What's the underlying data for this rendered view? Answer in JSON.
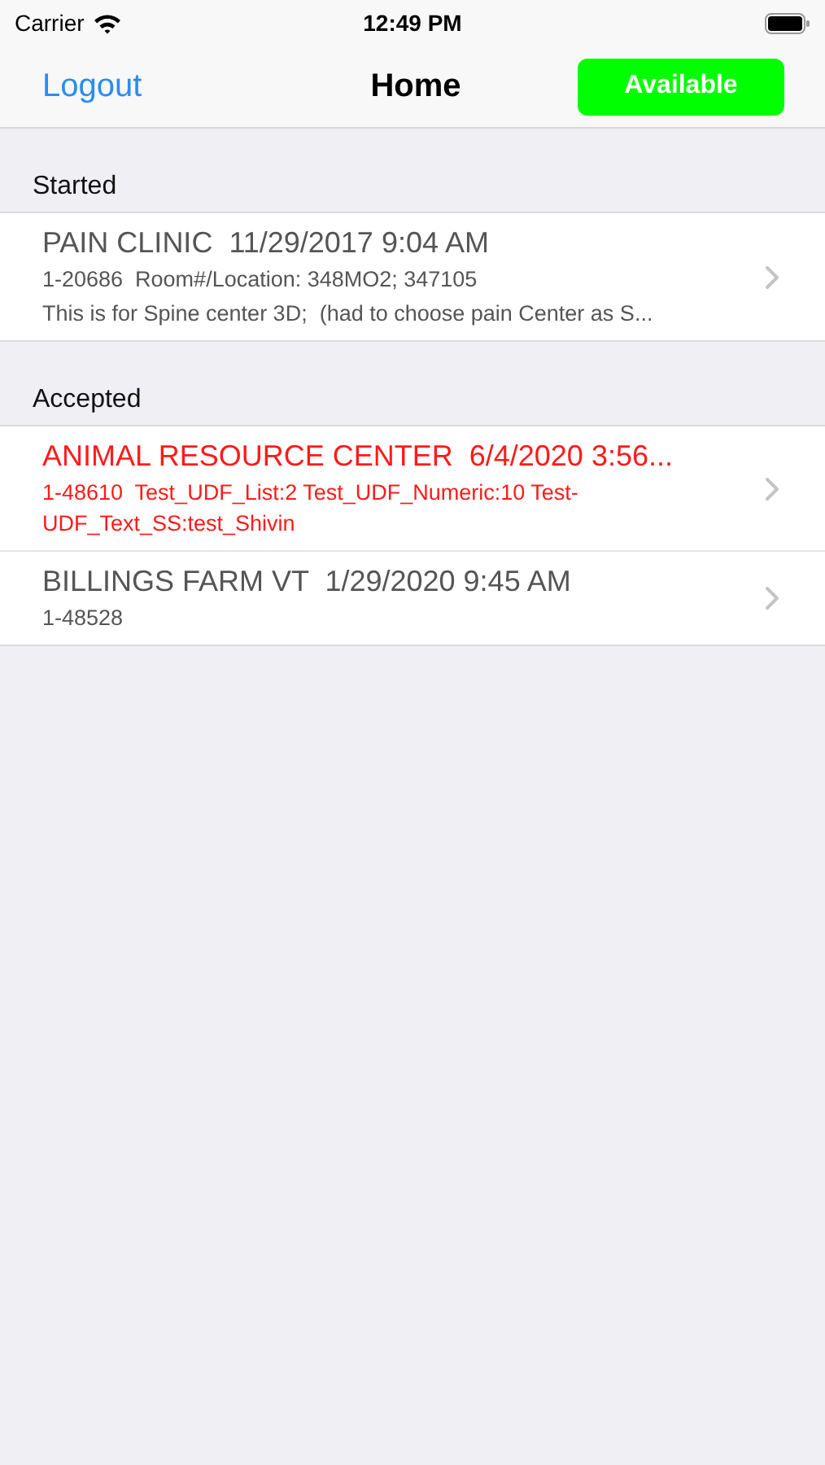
{
  "status_bar": {
    "carrier": "Carrier",
    "time": "12:49 PM"
  },
  "nav": {
    "left": "Logout",
    "title": "Home",
    "status_button": {
      "label": "Available",
      "color": "#00ff00"
    }
  },
  "sections": [
    {
      "header": "Started",
      "items": [
        {
          "title": "PAIN CLINIC  11/29/2017 9:04 AM",
          "lines": [
            "1-20686  Room#/Location: 348MO2; 347105",
            "This is for Spine center 3D;  (had to choose pain Center as S..."
          ],
          "color": "#555555"
        }
      ]
    },
    {
      "header": "Accepted",
      "items": [
        {
          "title": "ANIMAL RESOURCE CENTER  6/4/2020 3:56...",
          "lines": [
            "1-48610  Test_UDF_List:2 Test_UDF_Numeric:10 Test-UDF_Text_SS:test_Shivin"
          ],
          "color": "#ff1a1a"
        },
        {
          "title": "BILLINGS FARM VT  1/29/2020 9:45 AM",
          "lines": [
            "1-48528"
          ],
          "color": "#555555"
        }
      ]
    }
  ]
}
